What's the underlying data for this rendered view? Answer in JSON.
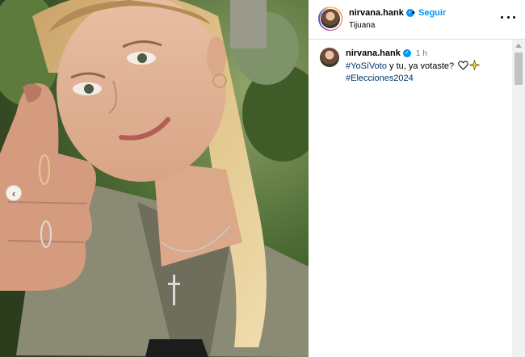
{
  "post": {
    "username": "nirvana.hank",
    "follow_label": "Seguir",
    "location": "Tijuana",
    "separator": "•"
  },
  "caption": {
    "username": "nirvana.hank",
    "time": "1 h",
    "hashtag1": "#YoSíVoto",
    "text": " y tu, ya votaste? ",
    "hashtag2": "#Elecciones2024"
  },
  "icons": {
    "verified": "verified-badge-icon",
    "more": "more-options-icon",
    "carousel_prev": "chevron-left-icon",
    "heart": "heart-icon",
    "sparkle": "sparkle-icon"
  },
  "colors": {
    "link_blue": "#0095f6",
    "hashtag_blue": "#00376b",
    "muted": "#737373"
  }
}
